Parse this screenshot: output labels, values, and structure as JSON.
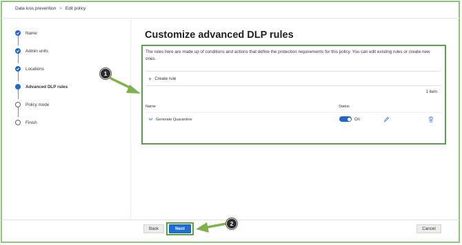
{
  "breadcrumb": {
    "items": [
      "Data loss prevention",
      "Edit policy"
    ],
    "separator": ">"
  },
  "stepper": {
    "steps": [
      {
        "label": "Name",
        "state": "done"
      },
      {
        "label": "Admin units",
        "state": "done"
      },
      {
        "label": "Locations",
        "state": "done"
      },
      {
        "label": "Advanced DLP rules",
        "state": "current"
      },
      {
        "label": "Policy mode",
        "state": "todo"
      },
      {
        "label": "Finish",
        "state": "todo"
      }
    ]
  },
  "main": {
    "title": "Customize advanced DLP rules",
    "description": "The rules here are made up of conditions and actions that define the protection requirements for this policy. You can edit existing rules or create new ones.",
    "create_rule_label": "Create rule",
    "item_count": "1 item",
    "columns": {
      "name": "Name",
      "status": "Status"
    },
    "rules": [
      {
        "name": "Generate Quarantine",
        "status": "On",
        "enabled": true
      }
    ]
  },
  "callouts": [
    "1",
    "2"
  ],
  "footer": {
    "back_label": "Back",
    "next_label": "Next",
    "cancel_label": "Cancel"
  },
  "colors": {
    "accent": "#2266c8",
    "highlight_border": "#57a04a",
    "arrow": "#7fb24f"
  }
}
